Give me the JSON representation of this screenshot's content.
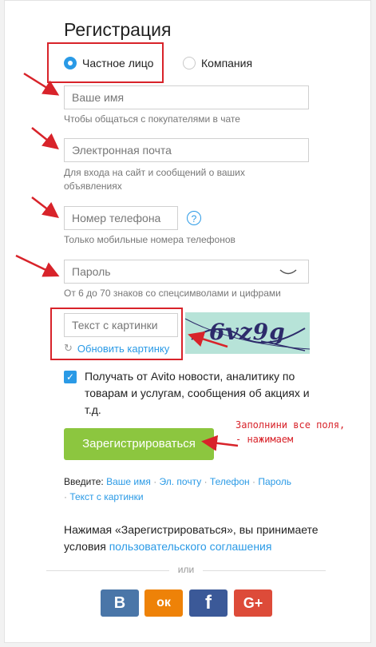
{
  "title": "Регистрация",
  "account_type": {
    "options": [
      {
        "label": "Частное лицо",
        "selected": true
      },
      {
        "label": "Компания",
        "selected": false
      }
    ]
  },
  "fields": {
    "name": {
      "placeholder": "Ваше имя",
      "hint": "Чтобы общаться с покупателями в чате"
    },
    "email": {
      "placeholder": "Электронная почта",
      "hint_line1": "Для входа на сайт и сообщений о ваших",
      "hint_line2": "объявлениях"
    },
    "phone": {
      "placeholder": "Номер телефона",
      "help_glyph": "?",
      "hint": "Только мобильные номера телефонов"
    },
    "password": {
      "placeholder": "Пароль",
      "hint": "От 6 до 70 знаков со спецсимволами и цифрами"
    },
    "captcha": {
      "placeholder": "Текст с картинки",
      "refresh_label": "Обновить картинку",
      "image_text": "6vz9g"
    }
  },
  "newsletter": {
    "checked": true,
    "label": "Получать от Avito новости, аналитику по товарам и услугам, сообщения об акциях и т.д."
  },
  "register_button": "Зарегистрироваться",
  "annotation": {
    "line1": "Заполнини все поля,",
    "line2": "- нажимаем"
  },
  "enter_hint": {
    "prefix": "Введите:",
    "links": [
      "Ваше имя",
      "Эл. почту",
      "Телефон",
      "Пароль",
      "Текст с картинки"
    ]
  },
  "terms": {
    "text": "Нажимая «Зарегистрироваться», вы принимаете условия",
    "link": "пользовательского соглашения"
  },
  "or_label": "или",
  "social": [
    {
      "name": "vk-icon",
      "glyph": "B",
      "color": "#4a76a8"
    },
    {
      "name": "odnoklassniki-icon",
      "glyph": "ок",
      "color": "#ee8208"
    },
    {
      "name": "facebook-icon",
      "glyph": "f",
      "color": "#3b5998"
    },
    {
      "name": "google-plus-icon",
      "glyph": "G+",
      "color": "#dd4b39"
    }
  ],
  "colors": {
    "accent": "#2a9ae6",
    "button": "#8cc63f",
    "annotation": "#d8232a"
  }
}
